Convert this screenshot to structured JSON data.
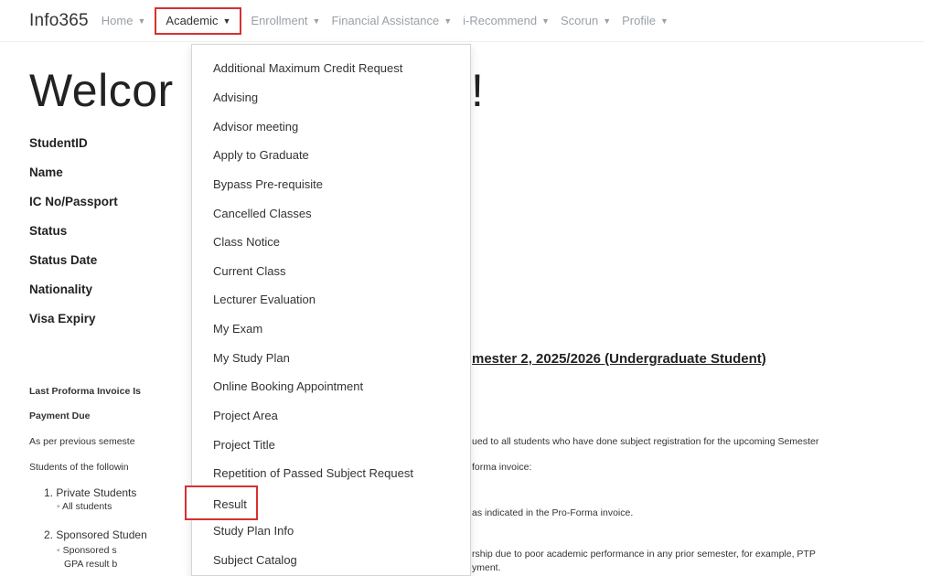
{
  "navbar": {
    "brand": "Info365",
    "items": [
      {
        "label": "Home"
      },
      {
        "label": "Academic"
      },
      {
        "label": "Enrollment"
      },
      {
        "label": "Financial Assistance"
      },
      {
        "label": "i-Recommend"
      },
      {
        "label": "Scorun"
      },
      {
        "label": "Profile"
      }
    ],
    "caret": "▼"
  },
  "welcome": {
    "start": "Welcor",
    "end": "!"
  },
  "info_labels": [
    "StudentID",
    "Name",
    "IC No/Passport",
    "Status",
    "Status Date",
    "Nationality",
    "Visa Expiry"
  ],
  "semester_title": "mester 2, 2025/2026 (Undergraduate Student)",
  "left_text": {
    "last_invoice": "Last Proforma Invoice Is",
    "payment_due": "Payment Due",
    "as_per": "As per previous semeste",
    "students_following": "Students of the followin",
    "item1": "1. Private Students",
    "item1_sub": "◦ All students",
    "item2": "2. Sponsored Studen",
    "item2_sub": "◦ Sponsored s",
    "item2_sub2": "GPA result b"
  },
  "right_text": {
    "issued": "ued to all students who have done subject registration for the upcoming Semester",
    "forma": "forma invoice:",
    "indicated": "as indicated in the Pro-Forma invoice.",
    "rship": "rship due to poor academic performance in any prior semester, for example, PTP",
    "ment": "yment."
  },
  "dropdown": {
    "items": [
      "Additional Maximum Credit Request",
      "Advising",
      "Advisor meeting",
      "Apply to Graduate",
      "Bypass Pre-requisite",
      "Cancelled Classes",
      "Class Notice",
      "Current Class",
      "Lecturer Evaluation",
      "My Exam",
      "My Study Plan",
      "Online Booking Appointment",
      "Project Area",
      "Project Title",
      "Repetition of Passed Subject Request",
      "Result",
      "Study Plan Info",
      "Subject Catalog"
    ]
  },
  "colors": {
    "highlight": "#d83030",
    "nav_inactive": "#9aa0a6"
  }
}
